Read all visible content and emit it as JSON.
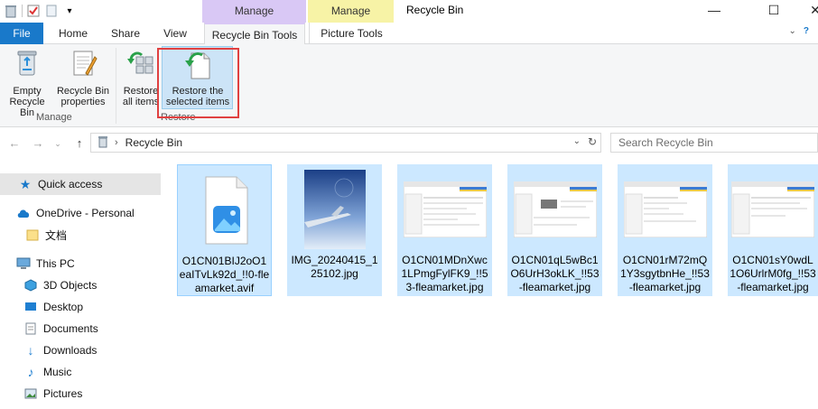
{
  "window": {
    "title": "Recycle Bin"
  },
  "context_tabs": {
    "manage1": "Manage",
    "manage2": "Manage"
  },
  "ribbon_tabs": {
    "file": "File",
    "home": "Home",
    "share": "Share",
    "view": "View",
    "recycle_bin_tools": "Recycle Bin Tools",
    "picture_tools": "Picture Tools"
  },
  "ribbon": {
    "empty_recycle_bin": "Empty Recycle Bin",
    "recycle_bin_properties": "Recycle Bin properties",
    "restore_all": "Restore all items",
    "restore_selected": "Restore the selected items",
    "group_manage": "Manage",
    "group_restore": "Restore"
  },
  "address": {
    "breadcrumb": "Recycle Bin",
    "search_placeholder": "Search Recycle Bin"
  },
  "nav": {
    "quick_access": "Quick access",
    "onedrive": "OneDrive - Personal",
    "docs_cn": "文档",
    "this_pc": "This PC",
    "objects3d": "3D Objects",
    "desktop": "Desktop",
    "documents": "Documents",
    "downloads": "Downloads",
    "music": "Music",
    "pictures": "Pictures"
  },
  "files": [
    {
      "name": "O1CN01BIJ2oO1eaITvLk92d_!!0-fleamarket.avif",
      "kind": "image-icon"
    },
    {
      "name": "IMG_20240415_125102.jpg",
      "kind": "photo"
    },
    {
      "name": "O1CN01MDnXwc1LPmgFylFK9_!!53-fleamarket.jpg",
      "kind": "screenshot"
    },
    {
      "name": "O1CN01qL5wBc1O6UrH3okLK_!!53-fleamarket.jpg",
      "kind": "screenshot"
    },
    {
      "name": "O1CN01rM72mQ1Y3sgytbnHe_!!53-fleamarket.jpg",
      "kind": "screenshot"
    },
    {
      "name": "O1CN01sY0wdL1O6UrlrM0fg_!!53-fleamarket.jpg",
      "kind": "screenshot"
    }
  ]
}
